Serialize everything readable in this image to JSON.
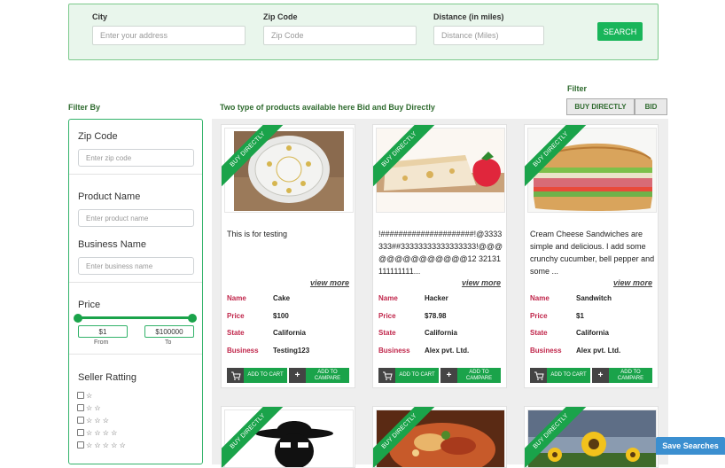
{
  "search": {
    "city_label": "City",
    "city_placeholder": "Enter your address",
    "zip_label": "Zip Code",
    "zip_placeholder": "Zip Code",
    "distance_label": "Distance (in miles)",
    "distance_placeholder": "Distance (Miles)",
    "button": "SEARCH"
  },
  "filter_by": "Filter By",
  "products_heading": "Two type of products available here Bid and Buy Directly",
  "filter": {
    "label": "Filter",
    "buy_directly": "BUY DIRECTLY",
    "bid": "BID"
  },
  "sidebar": {
    "zip_title": "Zip Code",
    "zip_placeholder": "Enter zip code",
    "product_title": "Product Name",
    "product_placeholder": "Enter product name",
    "business_title": "Business Name",
    "business_placeholder": "Enter business name",
    "price_title": "Price",
    "price_from": "$1",
    "price_to": "$100000",
    "from_label": "From",
    "to_label": "To",
    "rating_title": "Seller Ratting",
    "ratings": [
      "☆",
      "☆ ☆",
      "☆ ☆ ☆",
      "☆ ☆ ☆ ☆",
      "☆ ☆ ☆ ☆ ☆"
    ]
  },
  "ribbon": "BUY DIRECTLY",
  "labels": {
    "name": "Name",
    "price": "Price",
    "state": "State",
    "business": "Business",
    "view_more": "view more",
    "add_to_cart": "ADD TO CART",
    "add_to_compare": "ADD TO CAMPARE"
  },
  "products": [
    {
      "description": "This is for testing",
      "name": "Cake",
      "price": "$100",
      "state": "California",
      "business": "Testing123"
    },
    {
      "description": "!#####################!@3333333##33333333333333333!@@@@@@@@@@@@@@12 32131111111111...",
      "name": "Hacker",
      "price": "$78.98",
      "state": "California",
      "business": "Alex pvt. Ltd."
    },
    {
      "description": "Cream Cheese Sandwiches are simple and delicious. I add some crunchy cucumber, bell pepper and some ...",
      "name": "Sandwitch",
      "price": "$1",
      "state": "California",
      "business": "Alex pvt. Ltd."
    }
  ],
  "save_searches": "Save Searches",
  "colors": {
    "accent_green": "#1aa34a",
    "label_red": "#c0254a",
    "save_blue": "#3b8fd0"
  }
}
